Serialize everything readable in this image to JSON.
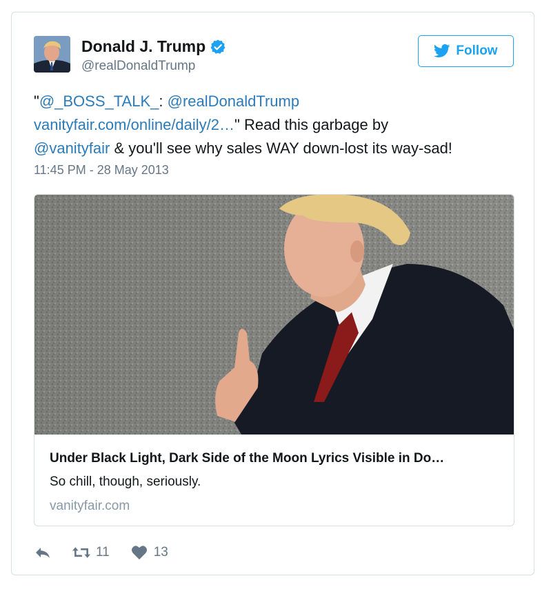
{
  "tweet": {
    "author": {
      "name": "Donald J. Trump",
      "handle": "@realDonaldTrump",
      "verified": true
    },
    "follow_label": "Follow",
    "text": {
      "quote_open": "\"",
      "mention_boss": "@_BOSS_TALK_",
      "colon": ": ",
      "mention_author": "@realDonaldTrump",
      "url": "vanityfair.com/online/daily/2…",
      "after_url": "\" Read this garbage by",
      "mention_vf": "@vanityfair",
      "rest": " & you'll see why sales WAY down-lost its way-sad!"
    },
    "timestamp": "11:45 PM - 28 May 2013"
  },
  "card": {
    "title": "Under Black Light, Dark Side of the Moon Lyrics Visible in Do…",
    "description": "So chill, though, seriously.",
    "domain": "vanityfair.com"
  },
  "actions": {
    "retweet_count": "11",
    "like_count": "13"
  },
  "colors": {
    "link": "#2b7bb9",
    "accent": "#1da1f2",
    "muted": "#657786",
    "tie": "#8b1a1a"
  },
  "icons": [
    "verified-badge-icon",
    "twitter-bird-icon",
    "reply-icon",
    "retweet-icon",
    "heart-icon"
  ]
}
